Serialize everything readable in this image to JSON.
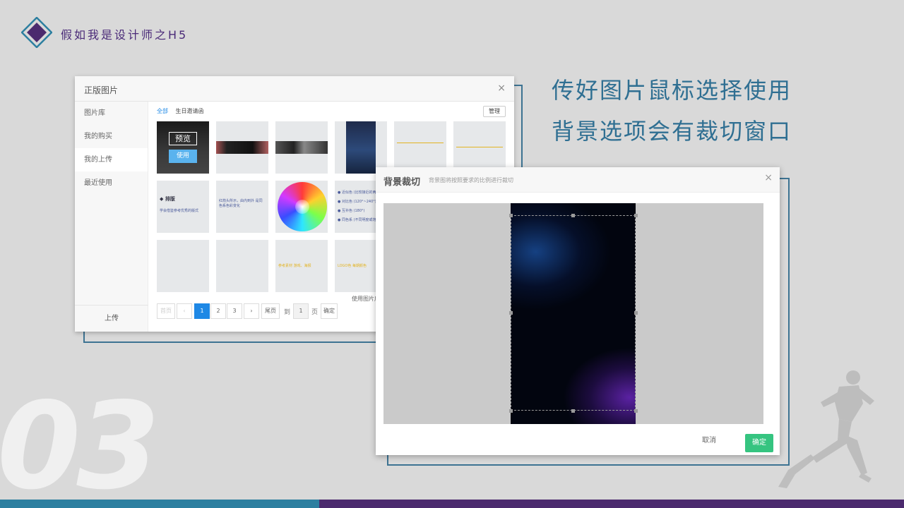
{
  "brand": {
    "title": "假如我是设计师之H5"
  },
  "slide_number": "03",
  "captions": [
    "传好图片鼠标选择使用",
    "背景选项会有裁切窗口"
  ],
  "colors": {
    "teal": "#2d7fa0",
    "purple": "#4b2a6e",
    "accent_blue": "#1e88e5",
    "confirm_green": "#35c480"
  },
  "gallery": {
    "title": "正版图片",
    "close": "×",
    "sidebar": [
      "图片库",
      "我的购买",
      "我的上传",
      "最近使用"
    ],
    "upload_label": "上传",
    "tabs": [
      "全部",
      "生日邀请函"
    ],
    "manage_label": "管理",
    "preview_label": "预览",
    "use_label": "使用",
    "thumb_texts": {
      "layout_title": "◆ 排版",
      "layout_body": "学会借鉴参考优秀的版式",
      "color_text": "红箭头所示，由内到外 是同色系色彩变化",
      "color_list": [
        "● 近似色 (比较接近的两个色)",
        "● 对比色 (120°~240°)",
        "● 互补色 (180°)",
        "● 同色系 (不同明度或饱和度)"
      ],
      "yellow_1": "参考素材  游戏、海报",
      "yellow_2": "LOGO色  每期颜色"
    },
    "used_label": "使用图片后",
    "pagination": {
      "first": "首页",
      "prev": "‹",
      "pages": [
        "1",
        "2",
        "3"
      ],
      "next": "›",
      "last": "尾页",
      "goto_label": "到",
      "goto_value": "1",
      "page_unit": "页",
      "confirm": "确定"
    }
  },
  "crop": {
    "title": "背景裁切",
    "subtitle": "背景图将按照要求的比例进行裁切",
    "close": "×",
    "cancel_label": "取消",
    "ok_label": "确定"
  }
}
